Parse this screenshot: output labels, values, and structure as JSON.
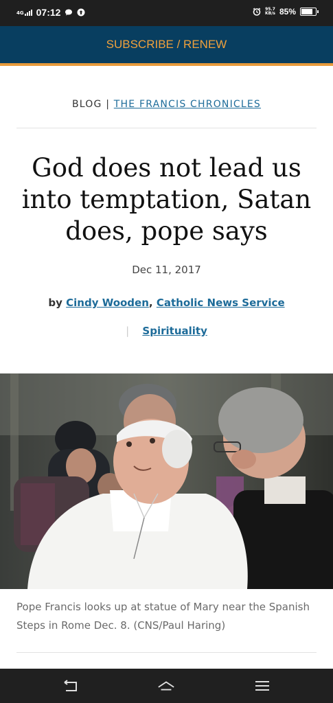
{
  "status_bar": {
    "network": "4G",
    "time": "07:12",
    "speed_top": "95.7",
    "speed_bottom": "KB/s",
    "battery_percent": "85%",
    "battery_level": 0.85
  },
  "header": {
    "subscribe_label": "SUBSCRIBE / RENEW"
  },
  "article": {
    "section": "BLOG",
    "separator": "|",
    "column": "THE FRANCIS CHRONICLES",
    "title": "God does not lead us into temptation, Satan does, pope says",
    "date": "Dec 11, 2017",
    "by": "by",
    "author": "Cindy Wooden",
    "comma": ",",
    "publisher": "Catholic News Service",
    "category_separator": "|",
    "category": "Spirituality",
    "caption": "Pope Francis looks up at statue of Mary near the Spanish Steps in Rome Dec. 8. (CNS/Paul Haring)"
  },
  "nav_bar": {
    "back_icon": "back-icon",
    "home_icon": "home-icon",
    "menu_icon": "menu-icon"
  },
  "colors": {
    "navy": "#083e60",
    "orange": "#f0a13c",
    "link_blue": "#1d6b99"
  }
}
